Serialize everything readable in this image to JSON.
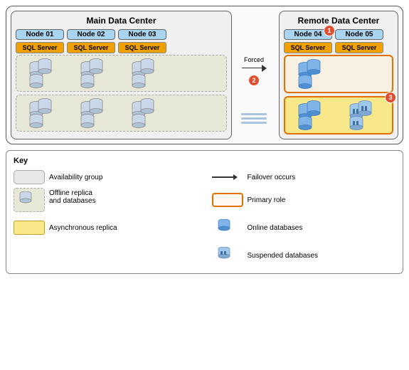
{
  "diagram": {
    "mainDC": {
      "title": "Main Data Center",
      "nodes": [
        {
          "label": "Node 01",
          "sql": "SQL Server"
        },
        {
          "label": "Node 02",
          "sql": "SQL Server"
        },
        {
          "label": "Node 03",
          "sql": "SQL Server"
        }
      ]
    },
    "remoteDC": {
      "title": "Remote Data Center",
      "nodes": [
        {
          "label": "Node 04",
          "sql": "SQL Server",
          "badge": "1"
        },
        {
          "label": "Node 05",
          "sql": "SQL Server"
        }
      ]
    },
    "arrow": {
      "label": "Forced",
      "badge": "2"
    },
    "row2badge": "3"
  },
  "key": {
    "title": "Key",
    "items": [
      {
        "id": "avail-group",
        "shape": "avail",
        "label": "Availability group"
      },
      {
        "id": "failover",
        "shape": "arrow",
        "label": "Failover occurs"
      },
      {
        "id": "offline-replica",
        "shape": "offline",
        "label": "Offline replica\nand databases"
      },
      {
        "id": "primary-role",
        "shape": "primary",
        "label": "Primary role"
      },
      {
        "id": "async-replica",
        "shape": "async",
        "label": "Asynchronous replica"
      },
      {
        "id": "online-db",
        "shape": "online-db",
        "label": "Online databases"
      },
      {
        "id": "suspended-db",
        "shape": "suspended-db",
        "label": "Suspended databases"
      }
    ]
  }
}
